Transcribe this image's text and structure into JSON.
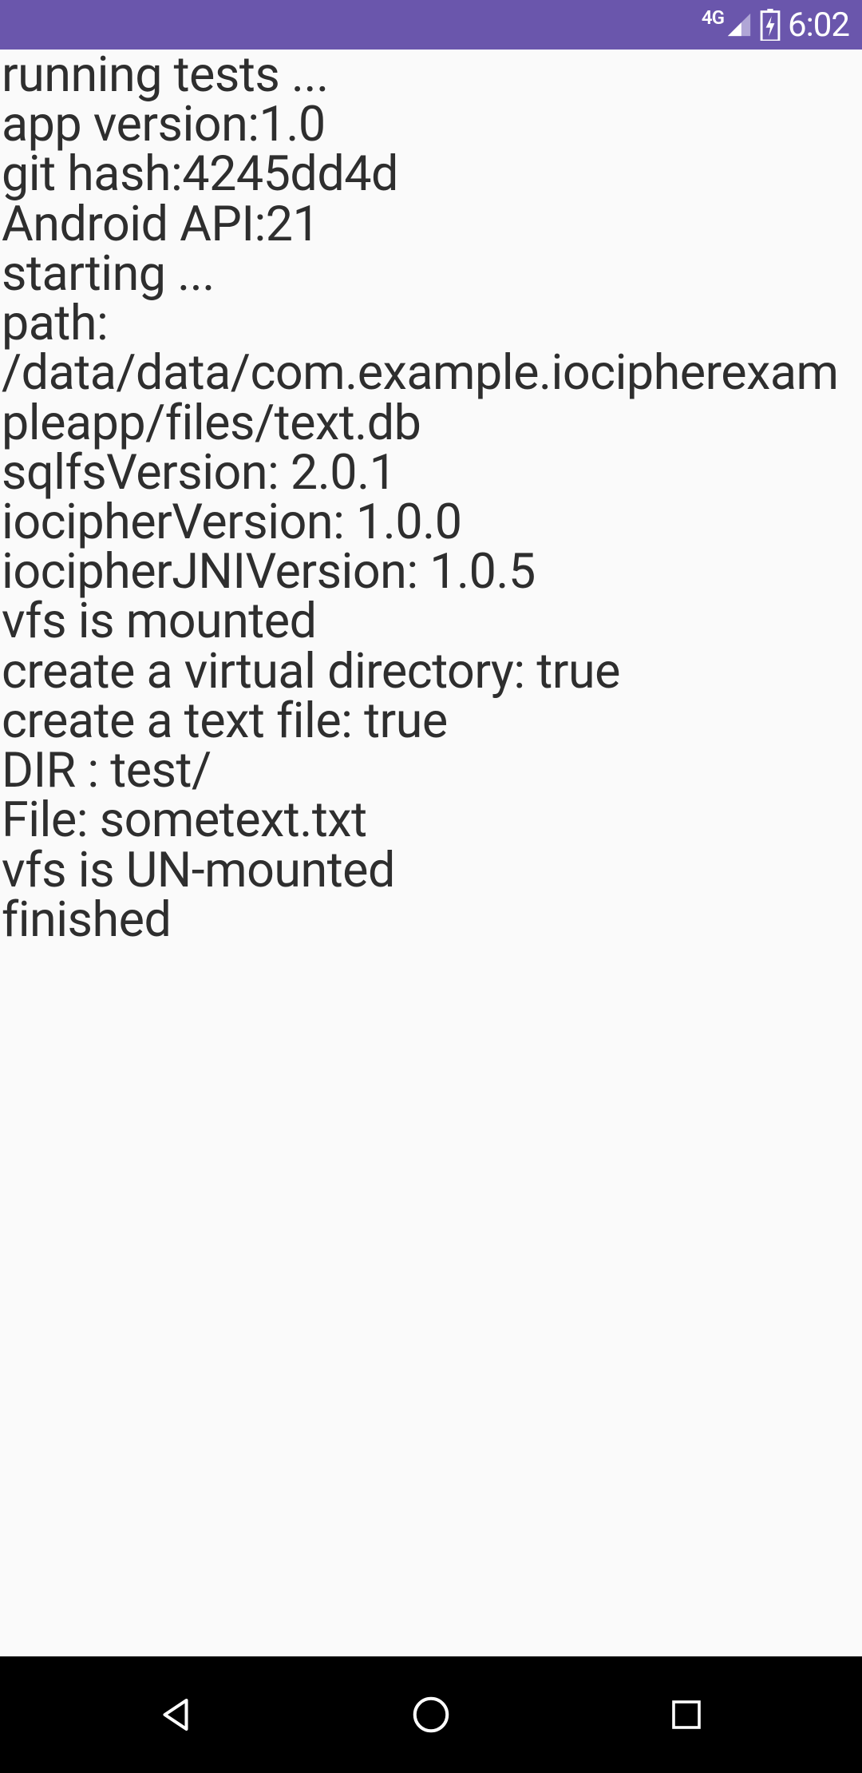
{
  "status_bar": {
    "network_label": "4G",
    "time": "6:02"
  },
  "log_lines": [
    "running tests ...",
    "app version:1.0",
    "git hash:4245dd4d",
    "Android API:21",
    "starting ...",
    "path: /data/data/com.example.iocipherexampleapp/files/text.db",
    "sqlfsVersion: 2.0.1",
    "iocipherVersion: 1.0.0",
    "iocipherJNIVersion: 1.0.5",
    "vfs is mounted",
    "create a virtual directory: true",
    "create a text file: true",
    "DIR : test/",
    "File: sometext.txt",
    "vfs is UN-mounted",
    "finished"
  ]
}
